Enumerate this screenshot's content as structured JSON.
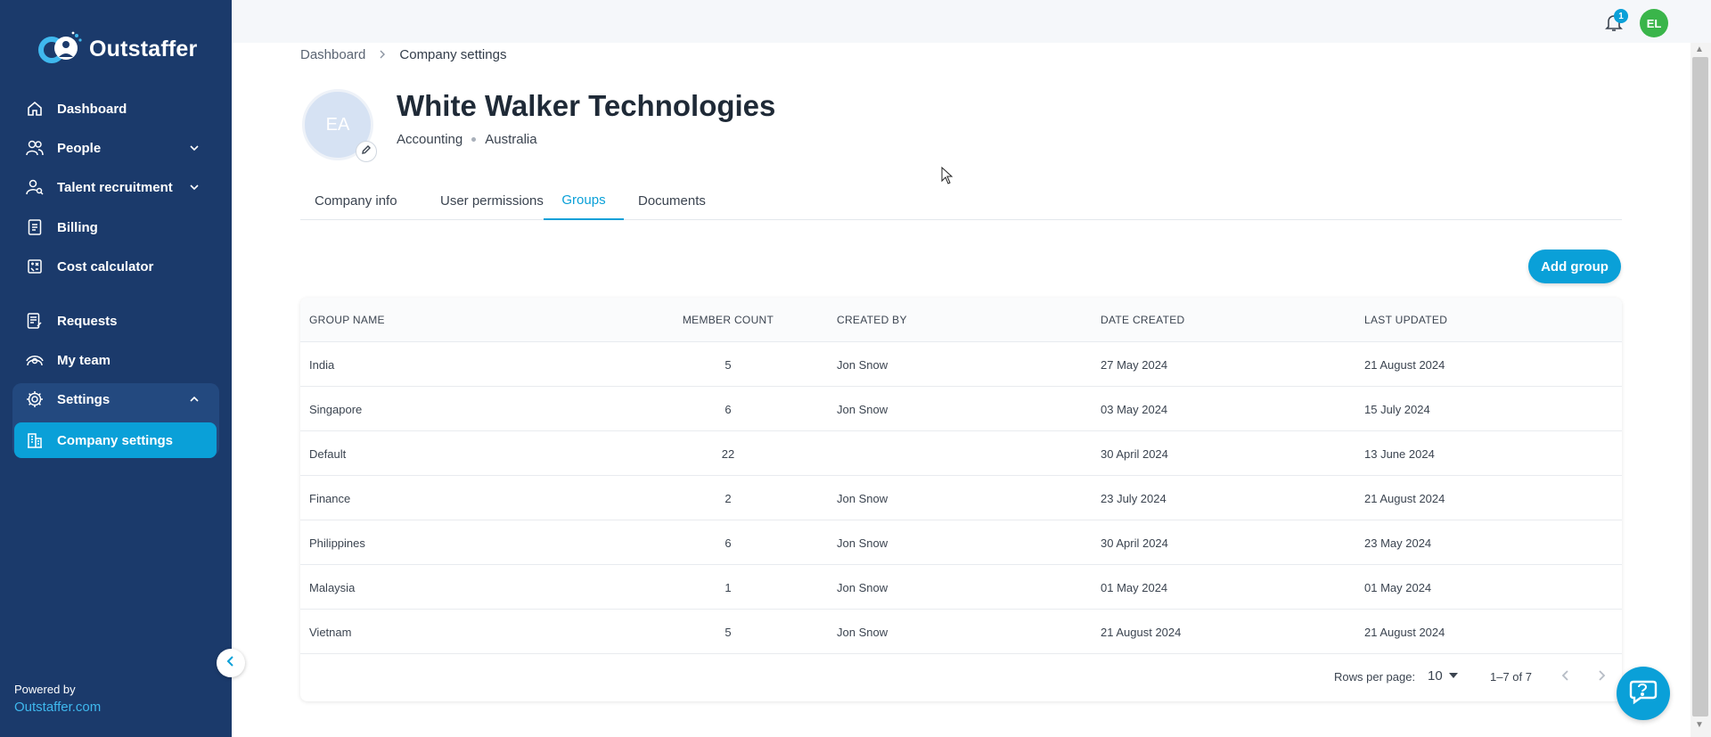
{
  "brand": {
    "name": "Outstaffer",
    "accent": "#0aa0d8",
    "sidebar_bg": "#1b3a6b"
  },
  "sidebar": {
    "items": [
      {
        "label": "Dashboard",
        "icon": "home-icon"
      },
      {
        "label": "People",
        "icon": "people-icon",
        "expandable": true
      },
      {
        "label": "Talent recruitment",
        "icon": "user-search-icon",
        "expandable": true
      },
      {
        "label": "Billing",
        "icon": "receipt-icon"
      },
      {
        "label": "Cost calculator",
        "icon": "calculator-icon"
      },
      {
        "label": "Requests",
        "icon": "request-icon"
      },
      {
        "label": "My team",
        "icon": "team-icon"
      },
      {
        "label": "Settings",
        "icon": "gear-icon",
        "expanded": true
      },
      {
        "label": "Company settings",
        "icon": "building-icon",
        "active": true
      }
    ],
    "powered_by": "Powered by",
    "powered_link": "Outstaffer.com"
  },
  "topbar": {
    "notification_count": "1",
    "user_initials": "EL"
  },
  "breadcrumb": {
    "root": "Dashboard",
    "current": "Company settings"
  },
  "company": {
    "avatar_initials": "EA",
    "name": "White Walker Technologies",
    "industry": "Accounting",
    "country": "Australia"
  },
  "tabs": [
    {
      "label": "Company info"
    },
    {
      "label": "User permissions"
    },
    {
      "label": "Groups",
      "active": true
    },
    {
      "label": "Documents"
    }
  ],
  "add_group_label": "Add group",
  "table": {
    "headers": [
      "GROUP NAME",
      "MEMBER COUNT",
      "CREATED BY",
      "DATE CREATED",
      "LAST UPDATED"
    ],
    "rows": [
      {
        "name": "India",
        "count": "5",
        "created_by": "Jon Snow",
        "date_created": "27 May 2024",
        "last_updated": "21 August 2024"
      },
      {
        "name": "Singapore",
        "count": "6",
        "created_by": "Jon Snow",
        "date_created": "03 May 2024",
        "last_updated": "15 July 2024"
      },
      {
        "name": "Default",
        "count": "22",
        "created_by": "",
        "date_created": "30 April 2024",
        "last_updated": "13 June 2024"
      },
      {
        "name": "Finance",
        "count": "2",
        "created_by": "Jon Snow",
        "date_created": "23 July 2024",
        "last_updated": "21 August 2024"
      },
      {
        "name": "Philippines",
        "count": "6",
        "created_by": "Jon Snow",
        "date_created": "30 April 2024",
        "last_updated": "23 May 2024"
      },
      {
        "name": "Malaysia",
        "count": "1",
        "created_by": "Jon Snow",
        "date_created": "01 May 2024",
        "last_updated": "01 May 2024"
      },
      {
        "name": "Vietnam",
        "count": "5",
        "created_by": "Jon Snow",
        "date_created": "21 August 2024",
        "last_updated": "21 August 2024"
      }
    ]
  },
  "pagination": {
    "rows_per_page_label": "Rows per page:",
    "rows_per_page": "10",
    "range": "1–7 of 7"
  }
}
